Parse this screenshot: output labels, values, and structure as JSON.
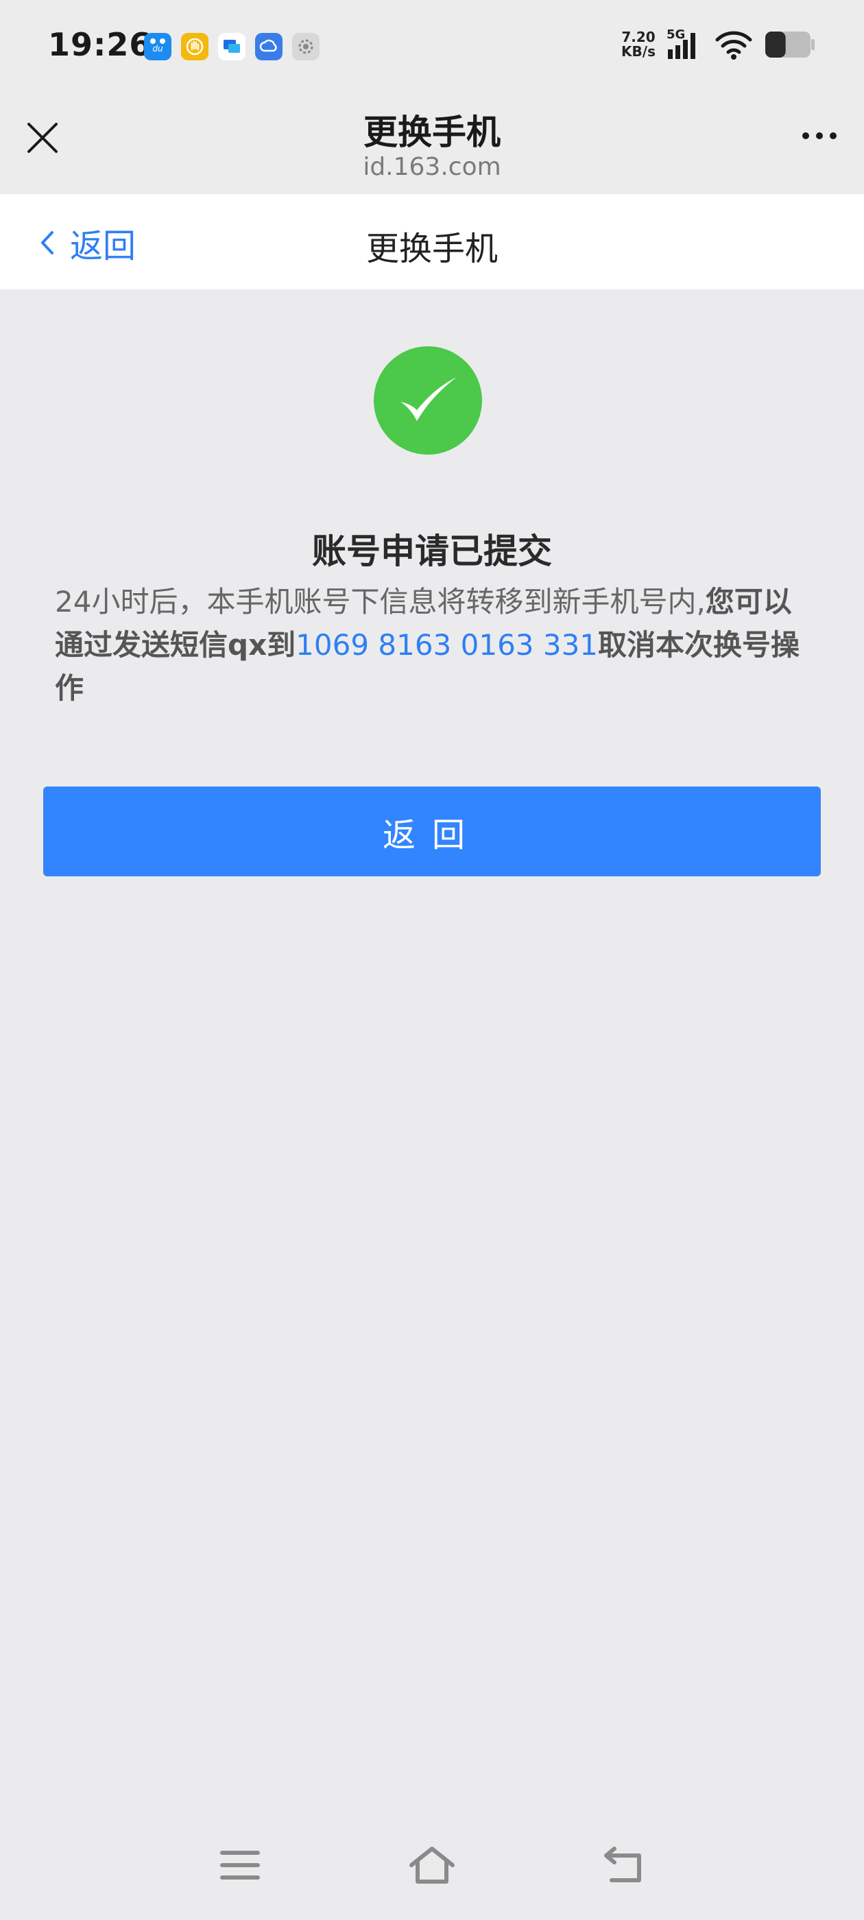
{
  "status_bar": {
    "time": "19:26",
    "net_speed_value": "7.20",
    "net_speed_unit": "KB/s",
    "network_type": "5G",
    "app_icons": [
      "du-icon",
      "hand-icon",
      "chat-icon",
      "cloud-icon",
      "gear-icon"
    ],
    "battery_level": 0.45
  },
  "browser": {
    "title": "更换手机",
    "domain": "id.163.com"
  },
  "page_nav": {
    "back_label": "返回",
    "title": "更换手机"
  },
  "result": {
    "title": "账号申请已提交",
    "desc_part1": "24小时后，本手机账号下信息将转移到新手机号内,",
    "desc_part2": "您可以通过发送短信qx到",
    "phone_number": "1069 8163 0163 331",
    "desc_part3": "取消本次换号操作"
  },
  "primary_button": {
    "label": "返回"
  },
  "colors": {
    "accent": "#3385ff",
    "link": "#2f7ff3",
    "success": "#4cc84a",
    "background": "#ebebed"
  }
}
